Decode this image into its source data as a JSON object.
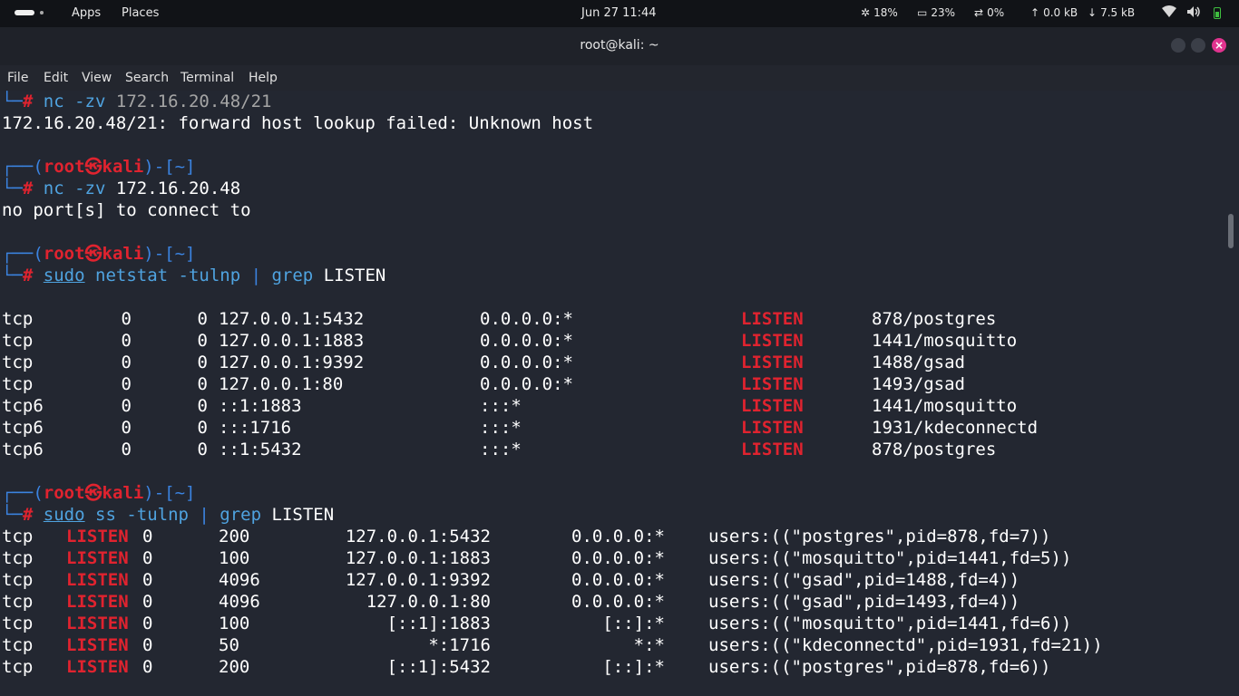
{
  "panel": {
    "apps": "Apps",
    "places": "Places",
    "clock": "Jun 27  11:44",
    "cpu": "18%",
    "mem": "23%",
    "swap": "0%",
    "net_up": "0.0 kB",
    "net_down": "7.5 kB"
  },
  "window": {
    "title": "root@kali: ~",
    "close": "×"
  },
  "menu": [
    "File",
    "Edit",
    "View",
    "Search",
    "Terminal",
    "Help"
  ],
  "terminal": {
    "prompt_corner": "└─",
    "prompt_top": "┌──(",
    "prompt_user": "root㉿kali",
    "prompt_path": ")-[~]",
    "hash": "#",
    "cmd1_a": "nc -zv ",
    "cmd1_b": "172.16.20.48/21",
    "out1": "172.16.20.48/21: forward host lookup failed: Unknown host",
    "cmd2_a": "nc -zv ",
    "cmd2_b": "172.16.20.48",
    "out2": "no port[s] to connect to",
    "cmd3": {
      "sudo": "sudo",
      "a": " netstat -tulnp ",
      "pipe": "|",
      "grep": " grep",
      "arg": " LISTEN"
    },
    "netstat": [
      {
        "proto": "tcp",
        "recv": "0",
        "send": "0",
        "local": "127.0.0.1:5432",
        "foreign": "0.0.0.0:*",
        "state": "LISTEN",
        "prog": "878/postgres"
      },
      {
        "proto": "tcp",
        "recv": "0",
        "send": "0",
        "local": "127.0.0.1:1883",
        "foreign": "0.0.0.0:*",
        "state": "LISTEN",
        "prog": "1441/mosquitto"
      },
      {
        "proto": "tcp",
        "recv": "0",
        "send": "0",
        "local": "127.0.0.1:9392",
        "foreign": "0.0.0.0:*",
        "state": "LISTEN",
        "prog": "1488/gsad"
      },
      {
        "proto": "tcp",
        "recv": "0",
        "send": "0",
        "local": "127.0.0.1:80",
        "foreign": "0.0.0.0:*",
        "state": "LISTEN",
        "prog": "1493/gsad"
      },
      {
        "proto": "tcp6",
        "recv": "0",
        "send": "0",
        "local": "::1:1883",
        "foreign": ":::*",
        "state": "LISTEN",
        "prog": "1441/mosquitto"
      },
      {
        "proto": "tcp6",
        "recv": "0",
        "send": "0",
        "local": ":::1716",
        "foreign": ":::*",
        "state": "LISTEN",
        "prog": "1931/kdeconnectd"
      },
      {
        "proto": "tcp6",
        "recv": "0",
        "send": "0",
        "local": "::1:5432",
        "foreign": ":::*",
        "state": "LISTEN",
        "prog": "878/postgres"
      }
    ],
    "cmd4": {
      "sudo": "sudo",
      "a": " ss -tulnp ",
      "pipe": "|",
      "grep": " grep",
      "arg": " LISTEN"
    },
    "ss": [
      {
        "net": "tcp",
        "state": "LISTEN",
        "recvq": "0",
        "sendq": "200",
        "local": "127.0.0.1:5432",
        "peer": "0.0.0.0:*",
        "proc": "users:((\"postgres\",pid=878,fd=7))"
      },
      {
        "net": "tcp",
        "state": "LISTEN",
        "recvq": "0",
        "sendq": "100",
        "local": "127.0.0.1:1883",
        "peer": "0.0.0.0:*",
        "proc": "users:((\"mosquitto\",pid=1441,fd=5))"
      },
      {
        "net": "tcp",
        "state": "LISTEN",
        "recvq": "0",
        "sendq": "4096",
        "local": "127.0.0.1:9392",
        "peer": "0.0.0.0:*",
        "proc": "users:((\"gsad\",pid=1488,fd=4))"
      },
      {
        "net": "tcp",
        "state": "LISTEN",
        "recvq": "0",
        "sendq": "4096",
        "local": "127.0.0.1:80",
        "peer": "0.0.0.0:*",
        "proc": "users:((\"gsad\",pid=1493,fd=4))"
      },
      {
        "net": "tcp",
        "state": "LISTEN",
        "recvq": "0",
        "sendq": "100",
        "local": "[::1]:1883",
        "peer": "[::]:*",
        "proc": "users:((\"mosquitto\",pid=1441,fd=6))"
      },
      {
        "net": "tcp",
        "state": "LISTEN",
        "recvq": "0",
        "sendq": "50",
        "local": "*:1716",
        "peer": "*:*",
        "proc": "users:((\"kdeconnectd\",pid=1931,fd=21))"
      },
      {
        "net": "tcp",
        "state": "LISTEN",
        "recvq": "0",
        "sendq": "200",
        "local": "[::1]:5432",
        "peer": "[::]:*",
        "proc": "users:((\"postgres\",pid=878,fd=6))"
      }
    ]
  }
}
